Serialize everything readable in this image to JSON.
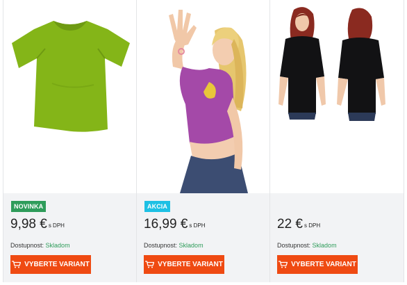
{
  "products": [
    {
      "badge": "NOVINKA",
      "badge_type": "new",
      "price": "9,98 €",
      "vat": "s DPH",
      "availability_label": "Dostupnost:",
      "availability_value": "Skladom",
      "button_label": "VYBERTE VARIANT",
      "image": "green-tshirt"
    },
    {
      "badge": "AKCIA",
      "badge_type": "sale",
      "price": "16,99 €",
      "vat": "s DPH",
      "availability_label": "Dostupnost:",
      "availability_value": "Skladom",
      "button_label": "VYBERTE VARIANT",
      "image": "woman-purple-top"
    },
    {
      "badge": "",
      "price": "22 €",
      "vat": "s DPH",
      "availability_label": "Dostupnost:",
      "availability_value": "Skladom",
      "button_label": "VYBERTE VARIANT",
      "image": "woman-black-tshirt-front-back"
    }
  ],
  "colors": {
    "button": "#ef4a12",
    "badge_new": "#2e9c5a",
    "badge_sale": "#1ec0e4",
    "stock": "#2e9c5a",
    "info_bg": "#f2f3f5"
  }
}
